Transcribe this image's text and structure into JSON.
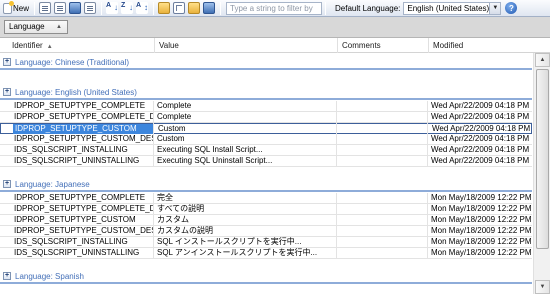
{
  "toolbar": {
    "new_label": "New",
    "filter_placeholder": "Type a string to filter by",
    "default_language_label": "Default Language:",
    "default_language_value": "English (United States)",
    "help_label": "?"
  },
  "groupby": {
    "chip_label": "Language"
  },
  "columns": {
    "identifier": "Identifier",
    "value": "Value",
    "comments": "Comments",
    "modified": "Modified"
  },
  "groups": [
    {
      "title": "Language: Chinese (Traditional)",
      "rows": []
    },
    {
      "title": "Language: English (United States)",
      "rows": [
        {
          "id": "IDPROP_SETUPTYPE_COMPLETE",
          "value": "Complete",
          "comments": "",
          "modified": "Wed Apr/22/2009 04:18 PM"
        },
        {
          "id": "IDPROP_SETUPTYPE_COMPLETE_DESC",
          "value": "Complete",
          "comments": "",
          "modified": "Wed Apr/22/2009 04:18 PM"
        },
        {
          "id": "IDPROP_SETUPTYPE_CUSTOM",
          "value": "Custom",
          "comments": "",
          "modified": "Wed Apr/22/2009 04:18 PM"
        },
        {
          "id": "IDPROP_SETUPTYPE_CUSTOM_DESC_PRO",
          "value": "Custom",
          "comments": "",
          "modified": "Wed Apr/22/2009 04:18 PM"
        },
        {
          "id": "IDS_SQLSCRIPT_INSTALLING",
          "value": "Executing SQL Install Script...",
          "comments": "",
          "modified": "Wed Apr/22/2009 04:18 PM"
        },
        {
          "id": "IDS_SQLSCRIPT_UNINSTALLING",
          "value": "Executing SQL Uninstall Script...",
          "comments": "",
          "modified": "Wed Apr/22/2009 04:18 PM"
        }
      ]
    },
    {
      "title": "Language: Japanese",
      "rows": [
        {
          "id": "IDPROP_SETUPTYPE_COMPLETE",
          "value": "完全",
          "comments": "",
          "modified": "Mon May/18/2009 12:22 PM"
        },
        {
          "id": "IDPROP_SETUPTYPE_COMPLETE_DESC",
          "value": "すべての説明",
          "comments": "",
          "modified": "Mon May/18/2009 12:22 PM"
        },
        {
          "id": "IDPROP_SETUPTYPE_CUSTOM",
          "value": "カスタム",
          "comments": "",
          "modified": "Mon May/18/2009 12:22 PM"
        },
        {
          "id": "IDPROP_SETUPTYPE_CUSTOM_DESC_PRO",
          "value": "カスタムの説明",
          "comments": "",
          "modified": "Mon May/18/2009 12:22 PM"
        },
        {
          "id": "IDS_SQLSCRIPT_INSTALLING",
          "value": "SQL インストールスクリプトを実行中...",
          "comments": "",
          "modified": "Mon May/18/2009 12:22 PM"
        },
        {
          "id": "IDS_SQLSCRIPT_UNINSTALLING",
          "value": "SQL アンインストールスクリプトを実行中...",
          "comments": "",
          "modified": "Mon May/18/2009 12:22 PM"
        }
      ]
    },
    {
      "title": "Language: Spanish",
      "rows": []
    }
  ],
  "selected": {
    "group": 1,
    "row": 2
  },
  "colors": {
    "group_title": "#4470b8",
    "selection": "#3d86dd",
    "group_line": "#8eacd9"
  }
}
